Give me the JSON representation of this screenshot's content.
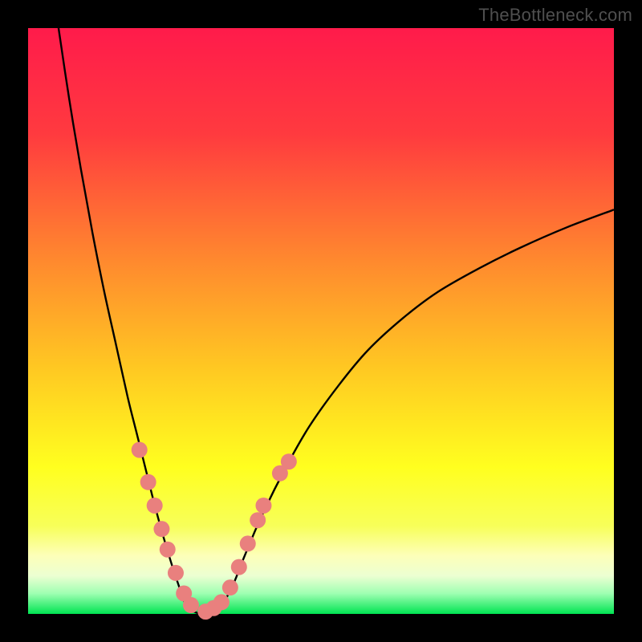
{
  "watermark": "TheBottleneck.com",
  "chart_data": {
    "type": "line",
    "title": "",
    "xlabel": "",
    "ylabel": "",
    "xlim": [
      0,
      100
    ],
    "ylim": [
      0,
      100
    ],
    "grid": false,
    "legend": false,
    "gradient_stops": [
      {
        "offset": 0,
        "color": "#ff1b4b"
      },
      {
        "offset": 0.18,
        "color": "#ff3a3f"
      },
      {
        "offset": 0.4,
        "color": "#ff8a2e"
      },
      {
        "offset": 0.58,
        "color": "#ffc822"
      },
      {
        "offset": 0.75,
        "color": "#ffff1f"
      },
      {
        "offset": 0.85,
        "color": "#f7ff59"
      },
      {
        "offset": 0.9,
        "color": "#fdffb8"
      },
      {
        "offset": 0.935,
        "color": "#ecffd2"
      },
      {
        "offset": 0.965,
        "color": "#9fffb2"
      },
      {
        "offset": 1.0,
        "color": "#00e452"
      }
    ],
    "series": [
      {
        "name": "curve-left",
        "type": "line",
        "color": "#000000",
        "x": [
          5.2,
          7.0,
          9.0,
          11.0,
          13.0,
          15.0,
          17.0,
          18.5,
          20.0,
          21.5,
          23.0,
          24.5,
          26.0,
          27.0
        ],
        "y": [
          100.0,
          88.0,
          76.0,
          65.0,
          55.0,
          46.0,
          37.0,
          31.0,
          25.0,
          19.0,
          13.5,
          8.5,
          4.0,
          1.2
        ]
      },
      {
        "name": "valley-floor",
        "type": "line",
        "color": "#000000",
        "x": [
          27.0,
          28.5,
          30.0,
          31.5,
          33.0
        ],
        "y": [
          1.2,
          0.3,
          0.0,
          0.3,
          1.2
        ]
      },
      {
        "name": "curve-right",
        "type": "line",
        "color": "#000000",
        "x": [
          33.0,
          35.0,
          37.0,
          40.0,
          44.0,
          48.0,
          53.0,
          58.0,
          64.0,
          70.0,
          77.0,
          84.0,
          92.0,
          100.0
        ],
        "y": [
          1.2,
          5.0,
          10.0,
          17.0,
          25.0,
          32.0,
          39.0,
          45.0,
          50.5,
          55.0,
          59.0,
          62.5,
          66.0,
          69.0
        ]
      },
      {
        "name": "markers-left",
        "type": "scatter",
        "color": "#e9807e",
        "marker_radius": 10,
        "x": [
          19.0,
          20.5,
          21.6,
          22.8,
          23.8,
          25.2,
          26.6,
          27.8
        ],
        "y": [
          28.0,
          22.5,
          18.5,
          14.5,
          11.0,
          7.0,
          3.5,
          1.5
        ]
      },
      {
        "name": "markers-right",
        "type": "scatter",
        "color": "#e9807e",
        "marker_radius": 10,
        "x": [
          30.3,
          31.7,
          33.0,
          34.5,
          36.0,
          37.5,
          39.2,
          40.2
        ],
        "y": [
          0.4,
          1.0,
          2.0,
          4.5,
          8.0,
          12.0,
          16.0,
          18.5
        ]
      },
      {
        "name": "markers-right-high",
        "type": "scatter",
        "color": "#e9807e",
        "marker_radius": 10,
        "x": [
          43.0,
          44.5
        ],
        "y": [
          24.0,
          26.0
        ]
      }
    ]
  }
}
